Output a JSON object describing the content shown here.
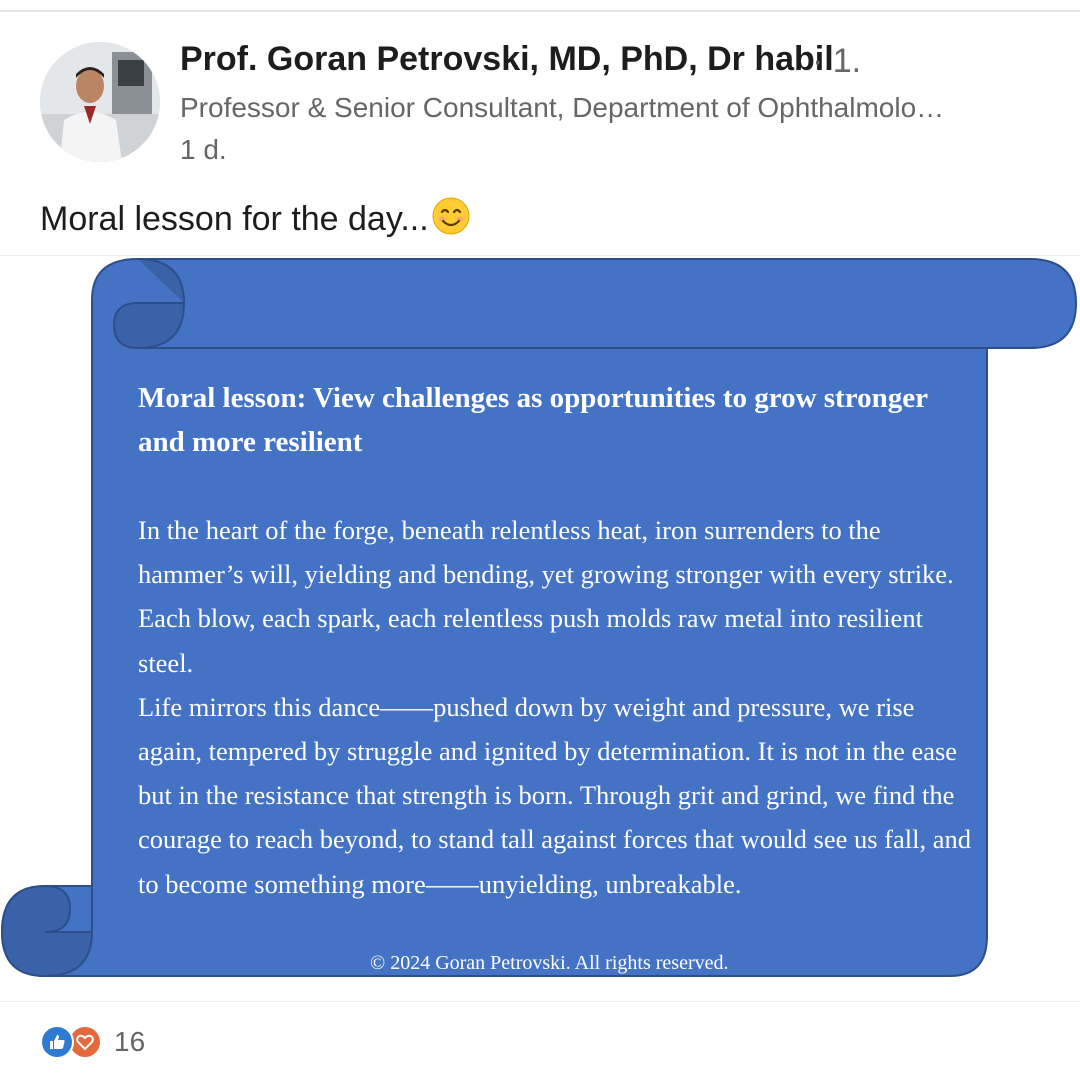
{
  "author": {
    "name": "Prof. Goran Petrovski, MD, PhD, Dr habil",
    "degree": "· 1.",
    "headline": "Professor & Senior Consultant, Department of Ophthalmolo…",
    "timestamp": "1 d."
  },
  "post": {
    "text": "Moral lesson for the day...",
    "emoji": "smiling-face-emoji"
  },
  "image": {
    "scroll_color": "#4472c4",
    "title": "Moral lesson: View challenges as opportunities to grow stronger and more resilient",
    "paragraph_1": "In the heart of the forge, beneath relentless heat, iron surrenders to the hammer’s will, yielding and bending, yet growing stronger with every strike. Each blow, each spark, each relentless push molds raw metal into resilient steel.",
    "paragraph_2": "Life mirrors this dance——pushed down by weight and pressure, we rise again, tempered by struggle and ignited by determination. It is not in the ease but in the resistance that strength is born. Through grit and grind, we find the courage to reach beyond, to stand tall against forces that would see us fall, and to become something more——unyielding, unbreakable.",
    "copyright": "© 2024 Goran Petrovski. All rights reserved."
  },
  "reactions": {
    "icons": [
      "like-icon",
      "love-icon"
    ],
    "count": "16"
  }
}
